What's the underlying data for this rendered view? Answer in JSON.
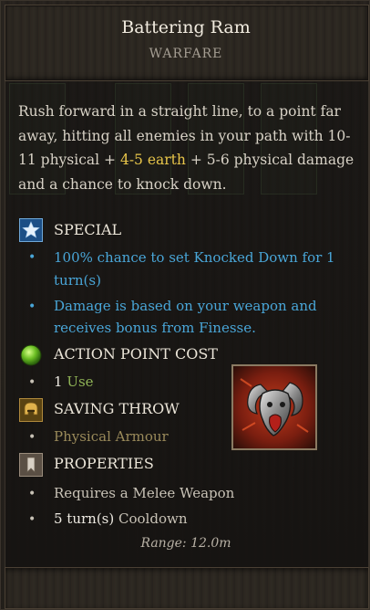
{
  "skill": {
    "title": "Battering Ram",
    "school": "WARFARE",
    "description_pre": "Rush forward in a straight line, to a point far away, hitting all enemies in your path with 10-11 physical + ",
    "description_earth": "4-5 earth",
    "description_post": " + 5-6 physical damage and a chance to knock down.",
    "range": "Range: 12.0m"
  },
  "sections": {
    "special": {
      "label": "SPECIAL",
      "icon": "star-icon",
      "items": [
        {
          "line1": "100% chance to set Knocked Down for 1",
          "line2": "turn(s)"
        },
        {
          "line1": "Damage is based on your weapon and",
          "line2": "receives bonus from Finesse."
        }
      ]
    },
    "ap_cost": {
      "label": "ACTION POINT COST",
      "icon": "green-orb-icon",
      "value": "1",
      "unit": "Use"
    },
    "saving_throw": {
      "label": "SAVING THROW",
      "icon": "helmet-icon",
      "value": "Physical Armour"
    },
    "properties": {
      "label": "PROPERTIES",
      "icon": "bookmark-icon",
      "requirement": "Requires a Melee Weapon",
      "cooldown_value": "5 turn(s)",
      "cooldown_label": "Cooldown"
    }
  },
  "colors": {
    "title": "#f2ece0",
    "earth_damage": "#e8c64a",
    "special_text": "#49a6d8",
    "ap_text": "#8fb356",
    "saving_throw_text": "#9a8a5a"
  }
}
